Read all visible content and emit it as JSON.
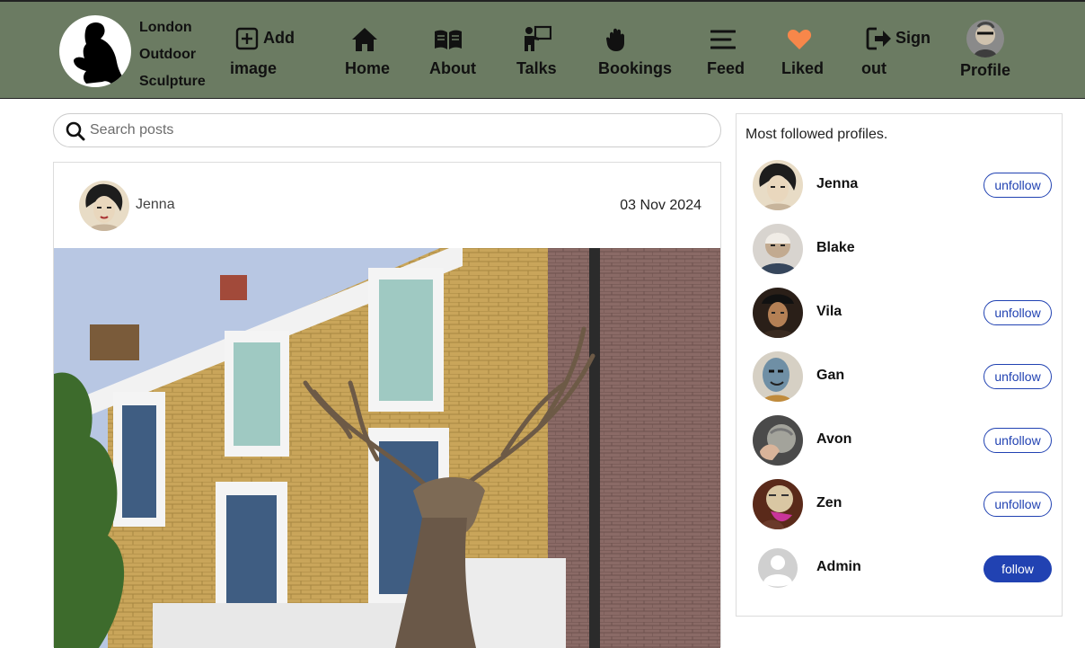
{
  "brand": {
    "lines": [
      "London",
      "Outdoor",
      "Sculpture"
    ]
  },
  "nav": {
    "add_image": {
      "line1": "Add",
      "line2": "image",
      "icon": "plus-square-icon"
    },
    "home": {
      "label": "Home",
      "icon": "house-icon"
    },
    "about": {
      "label": "About",
      "icon": "open-book-icon"
    },
    "talks": {
      "label": "Talks",
      "icon": "presenter-icon"
    },
    "bookings": {
      "label": "Bookings",
      "icon": "raised-hand-icon"
    },
    "feed": {
      "label": "Feed",
      "icon": "stream-lines-icon"
    },
    "liked": {
      "label": "Liked",
      "icon": "heart-icon"
    },
    "signout": {
      "line1": "Sign",
      "line2": "out",
      "icon": "sign-out-icon"
    },
    "profile": {
      "label": "Profile"
    }
  },
  "search": {
    "placeholder": "Search posts"
  },
  "post": {
    "author": "Jenna",
    "date": "03 Nov 2024"
  },
  "profiles_panel": {
    "title": "Most followed profiles.",
    "profiles": [
      {
        "name": "Jenna",
        "action": "unfollow"
      },
      {
        "name": "Blake",
        "action": ""
      },
      {
        "name": "Vila",
        "action": "unfollow"
      },
      {
        "name": "Gan",
        "action": "unfollow"
      },
      {
        "name": "Avon",
        "action": "unfollow"
      },
      {
        "name": "Zen",
        "action": "unfollow"
      },
      {
        "name": "Admin",
        "action": "follow"
      }
    ]
  },
  "colors": {
    "navbar": "#6b7b62",
    "accent": "#2142b2",
    "heart": "#f7874a"
  }
}
